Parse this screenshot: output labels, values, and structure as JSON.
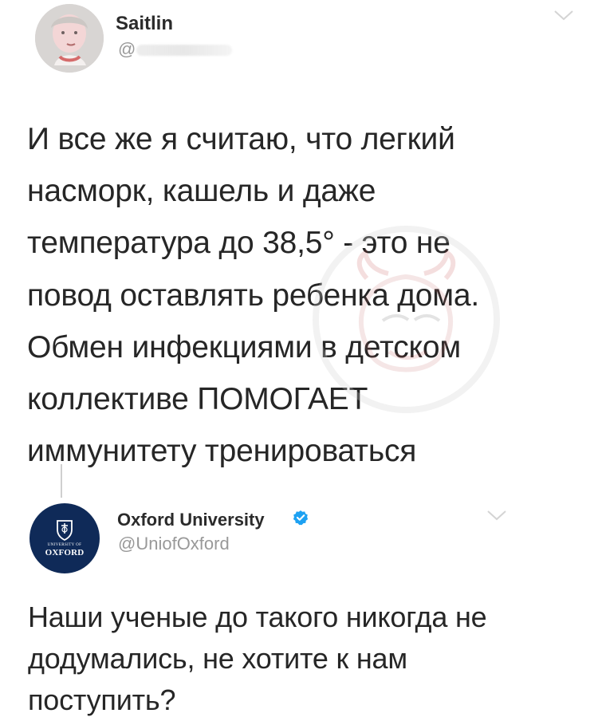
{
  "first_tweet": {
    "name": "Saitlin",
    "handle_prefix": "@",
    "text_lines": [
      "И все же я считаю, что легкий",
      "насморк, кашель и даже",
      "температура до 38,5° - это не",
      "повод оставлять ребенка дома.",
      "Обмен инфекциями в детском",
      "коллективе ПОМОГАЕТ",
      "иммунитету тренироваться"
    ],
    "icon": "chevron-down-icon"
  },
  "reply_tweet": {
    "name": "Oxford University",
    "handle": "@UniofOxford",
    "avatar_text": {
      "small": "UNIVERSITY OF",
      "main": "OXFORD"
    },
    "text_lines": [
      "Наши ученые до такого никогда не",
      "додумались, не хотите к нам",
      "поступить?"
    ],
    "icon": "chevron-down-icon"
  },
  "colors": {
    "text": "#262626",
    "muted": "#999999",
    "oxford_blue": "#0f2a58",
    "verified_blue": "#1da1f2"
  }
}
